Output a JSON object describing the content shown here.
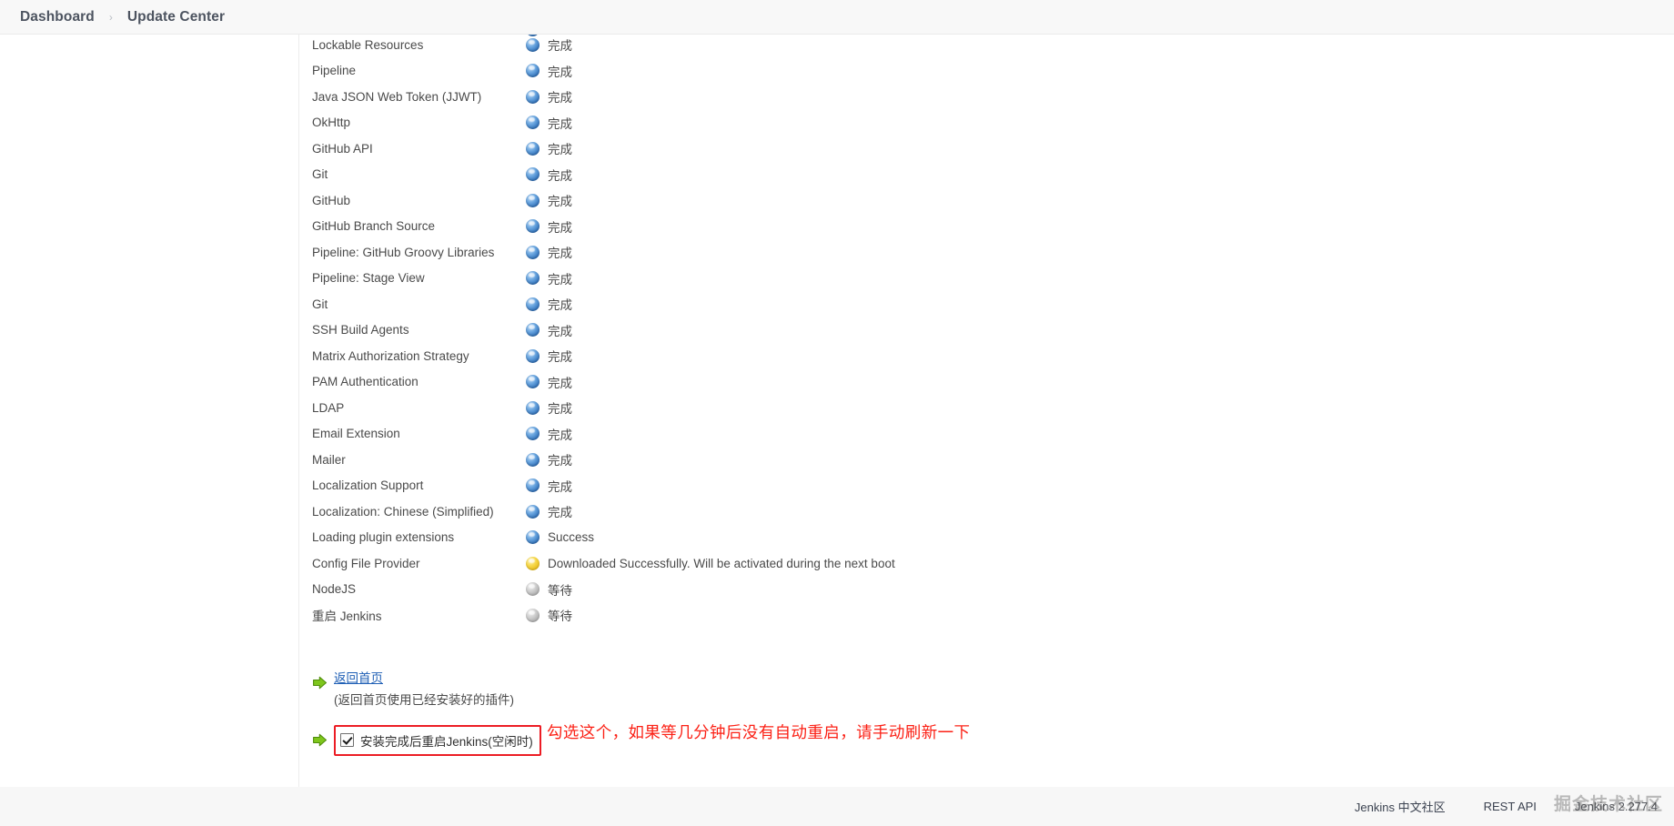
{
  "breadcrumb": {
    "dashboard": "Dashboard",
    "separator": "›",
    "current": "Update Center"
  },
  "install_list": {
    "clipped_top_row": {
      "name": "",
      "status": ""
    },
    "rows": [
      {
        "name": "Lockable Resources",
        "status": "完成",
        "ball": "blue"
      },
      {
        "name": "Pipeline",
        "status": "完成",
        "ball": "blue"
      },
      {
        "name": "Java JSON Web Token (JJWT)",
        "status": "完成",
        "ball": "blue"
      },
      {
        "name": "OkHttp",
        "status": "完成",
        "ball": "blue"
      },
      {
        "name": "GitHub API",
        "status": "完成",
        "ball": "blue"
      },
      {
        "name": "Git",
        "status": "完成",
        "ball": "blue"
      },
      {
        "name": "GitHub",
        "status": "完成",
        "ball": "blue"
      },
      {
        "name": "GitHub Branch Source",
        "status": "完成",
        "ball": "blue"
      },
      {
        "name": "Pipeline: GitHub Groovy Libraries",
        "status": "完成",
        "ball": "blue"
      },
      {
        "name": "Pipeline: Stage View",
        "status": "完成",
        "ball": "blue"
      },
      {
        "name": "Git",
        "status": "完成",
        "ball": "blue"
      },
      {
        "name": "SSH Build Agents",
        "status": "完成",
        "ball": "blue"
      },
      {
        "name": "Matrix Authorization Strategy",
        "status": "完成",
        "ball": "blue"
      },
      {
        "name": "PAM Authentication",
        "status": "完成",
        "ball": "blue"
      },
      {
        "name": "LDAP",
        "status": "完成",
        "ball": "blue"
      },
      {
        "name": "Email Extension",
        "status": "完成",
        "ball": "blue"
      },
      {
        "name": "Mailer",
        "status": "完成",
        "ball": "blue"
      },
      {
        "name": "Localization Support",
        "status": "完成",
        "ball": "blue"
      },
      {
        "name": "Localization: Chinese (Simplified)",
        "status": "完成",
        "ball": "blue"
      },
      {
        "name": "Loading plugin extensions",
        "status": "Success",
        "ball": "blue"
      },
      {
        "name": "Config File Provider",
        "status": "Downloaded Successfully. Will be activated during the next boot",
        "ball": "yellow"
      },
      {
        "name": "NodeJS",
        "status": "等待",
        "ball": "grey"
      },
      {
        "name": "重启 Jenkins",
        "status": "等待",
        "ball": "grey"
      }
    ]
  },
  "actions": {
    "home_link": "返回首页",
    "home_note": "(返回首页使用已经安装好的插件)",
    "restart_checkbox_label": "安装完成后重启Jenkins(空闲时)",
    "restart_checked": true,
    "highlight_color": "#ec1c24"
  },
  "annotation": {
    "text": "勾选这个，如果等几分钟后没有自动重启，请手动刷新一下",
    "color": "#fb2015"
  },
  "footer": {
    "community": "Jenkins 中文社区",
    "rest_api": "REST API",
    "version": "Jenkins 2.277.4",
    "watermark": "掘金技术社区"
  }
}
